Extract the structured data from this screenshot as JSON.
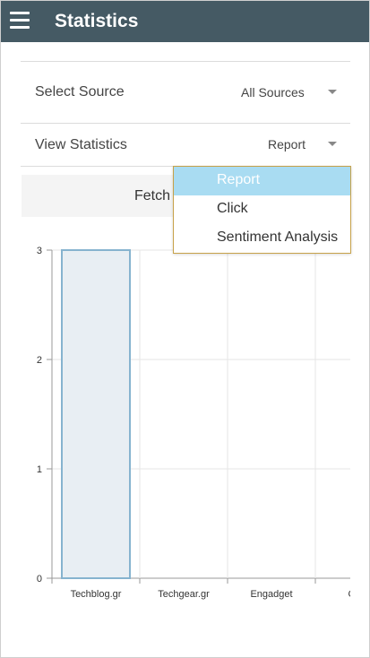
{
  "header": {
    "title": "Statistics"
  },
  "filters": {
    "source": {
      "label": "Select Source",
      "value": "All Sources"
    },
    "view": {
      "label": "View Statistics",
      "value": "Report"
    }
  },
  "fetch_button": {
    "label": "Fetch"
  },
  "view_menu": {
    "options": [
      {
        "label": "Report",
        "selected": true
      },
      {
        "label": "Click",
        "selected": false
      },
      {
        "label": "Sentiment Analysis",
        "selected": false
      }
    ]
  },
  "colors": {
    "appbar": "#455a64",
    "bar_fill": "#e8eef3",
    "bar_stroke": "#86b3cf",
    "menu_highlight": "#a9dcf2",
    "menu_border": "#c7a24a"
  },
  "chart_data": {
    "type": "bar",
    "categories": [
      "Techblog.gr",
      "Techgear.gr",
      "Engadget",
      "GSM"
    ],
    "values": [
      3,
      0,
      0,
      0
    ],
    "ylim": [
      0,
      3
    ],
    "yticks": [
      0,
      1,
      2,
      3
    ],
    "grid": true,
    "title": "",
    "xlabel": "",
    "ylabel": ""
  }
}
